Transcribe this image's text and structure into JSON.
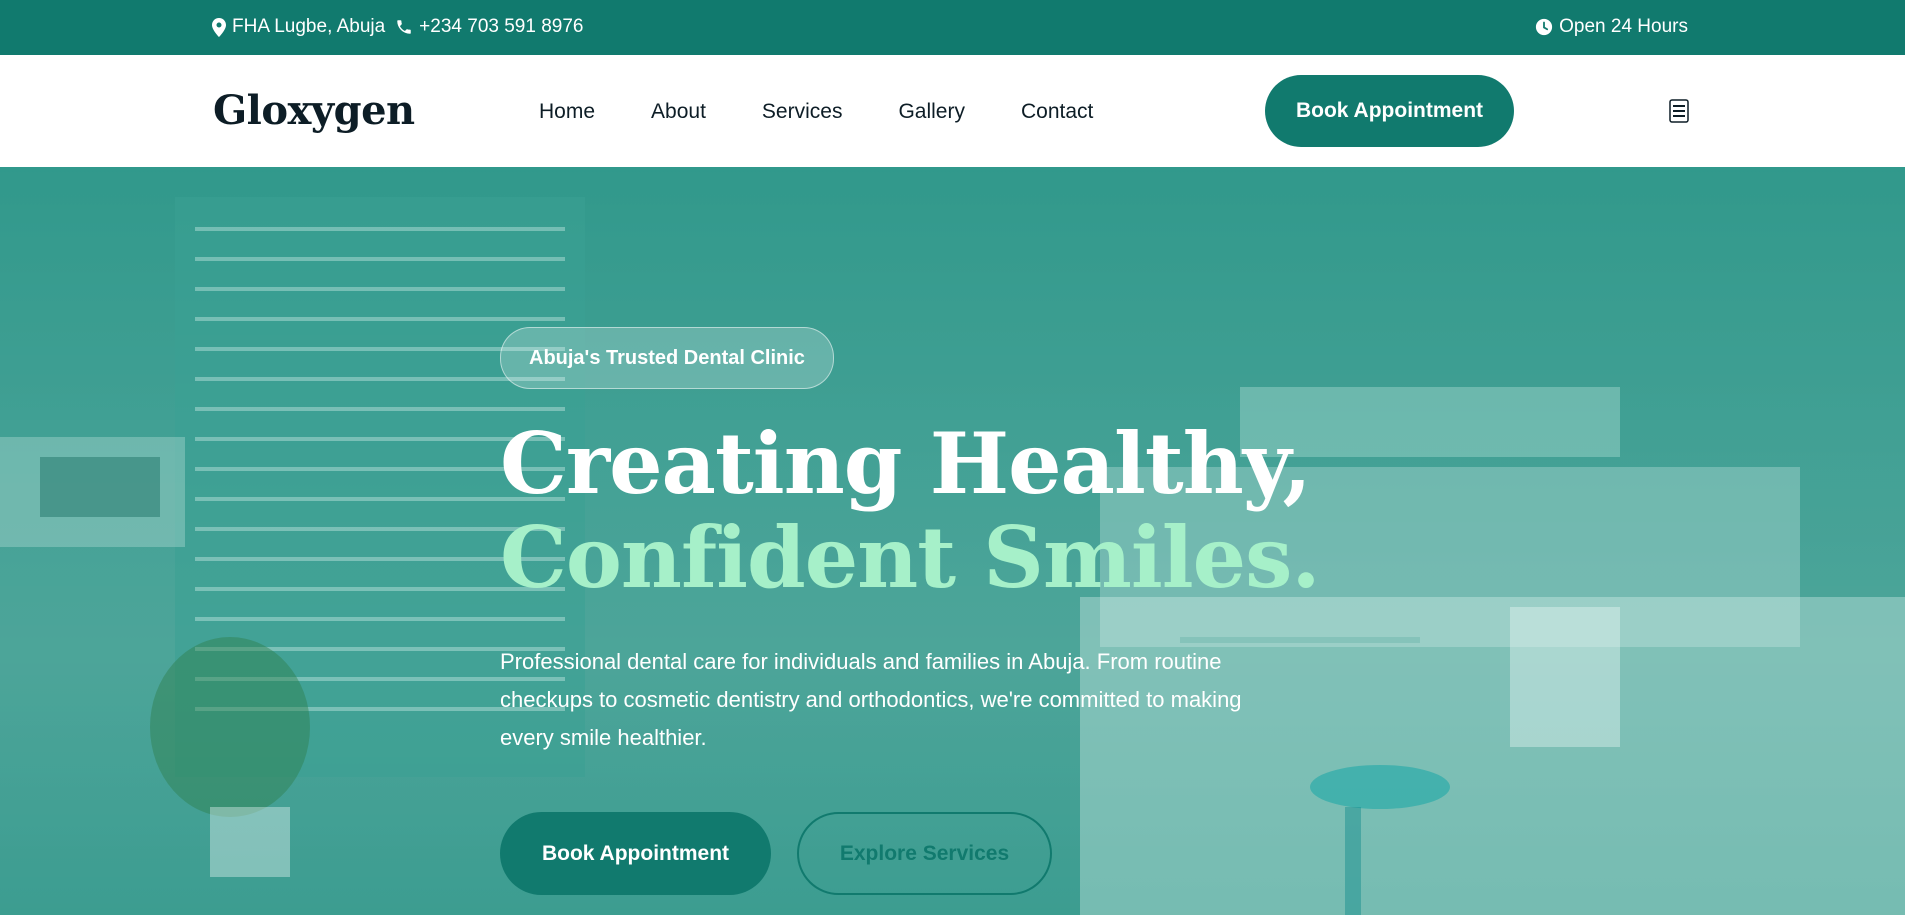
{
  "topbar": {
    "location": "FHA Lugbe, Abuja",
    "phone": "+234 703 591 8976",
    "hours": "Open 24 Hours",
    "icons": [
      "map-pin-icon",
      "phone-icon",
      "clock-icon"
    ]
  },
  "nav": {
    "logo": "Gloxygen",
    "items": [
      {
        "label": "Home"
      },
      {
        "label": "About"
      },
      {
        "label": "Services"
      },
      {
        "label": "Gallery"
      },
      {
        "label": "Contact"
      }
    ],
    "cta": "Book Appointment",
    "menu_icon": "hamburger-menu-icon"
  },
  "hero": {
    "badge": "Abuja's Trusted Dental Clinic",
    "title_line1": "Creating Healthy,",
    "title_line2": "Confident Smiles.",
    "description": "Professional dental care for individuals and families in Abuja. From routine checkups to cosmetic dentistry and orthodontics, we're committed to making every smile healthier.",
    "primary_button": "Book Appointment",
    "secondary_button": "Explore Services"
  },
  "colors": {
    "brand": "#117a6e",
    "accent": "#a6f0c9",
    "text_dark": "#0d1d26"
  }
}
